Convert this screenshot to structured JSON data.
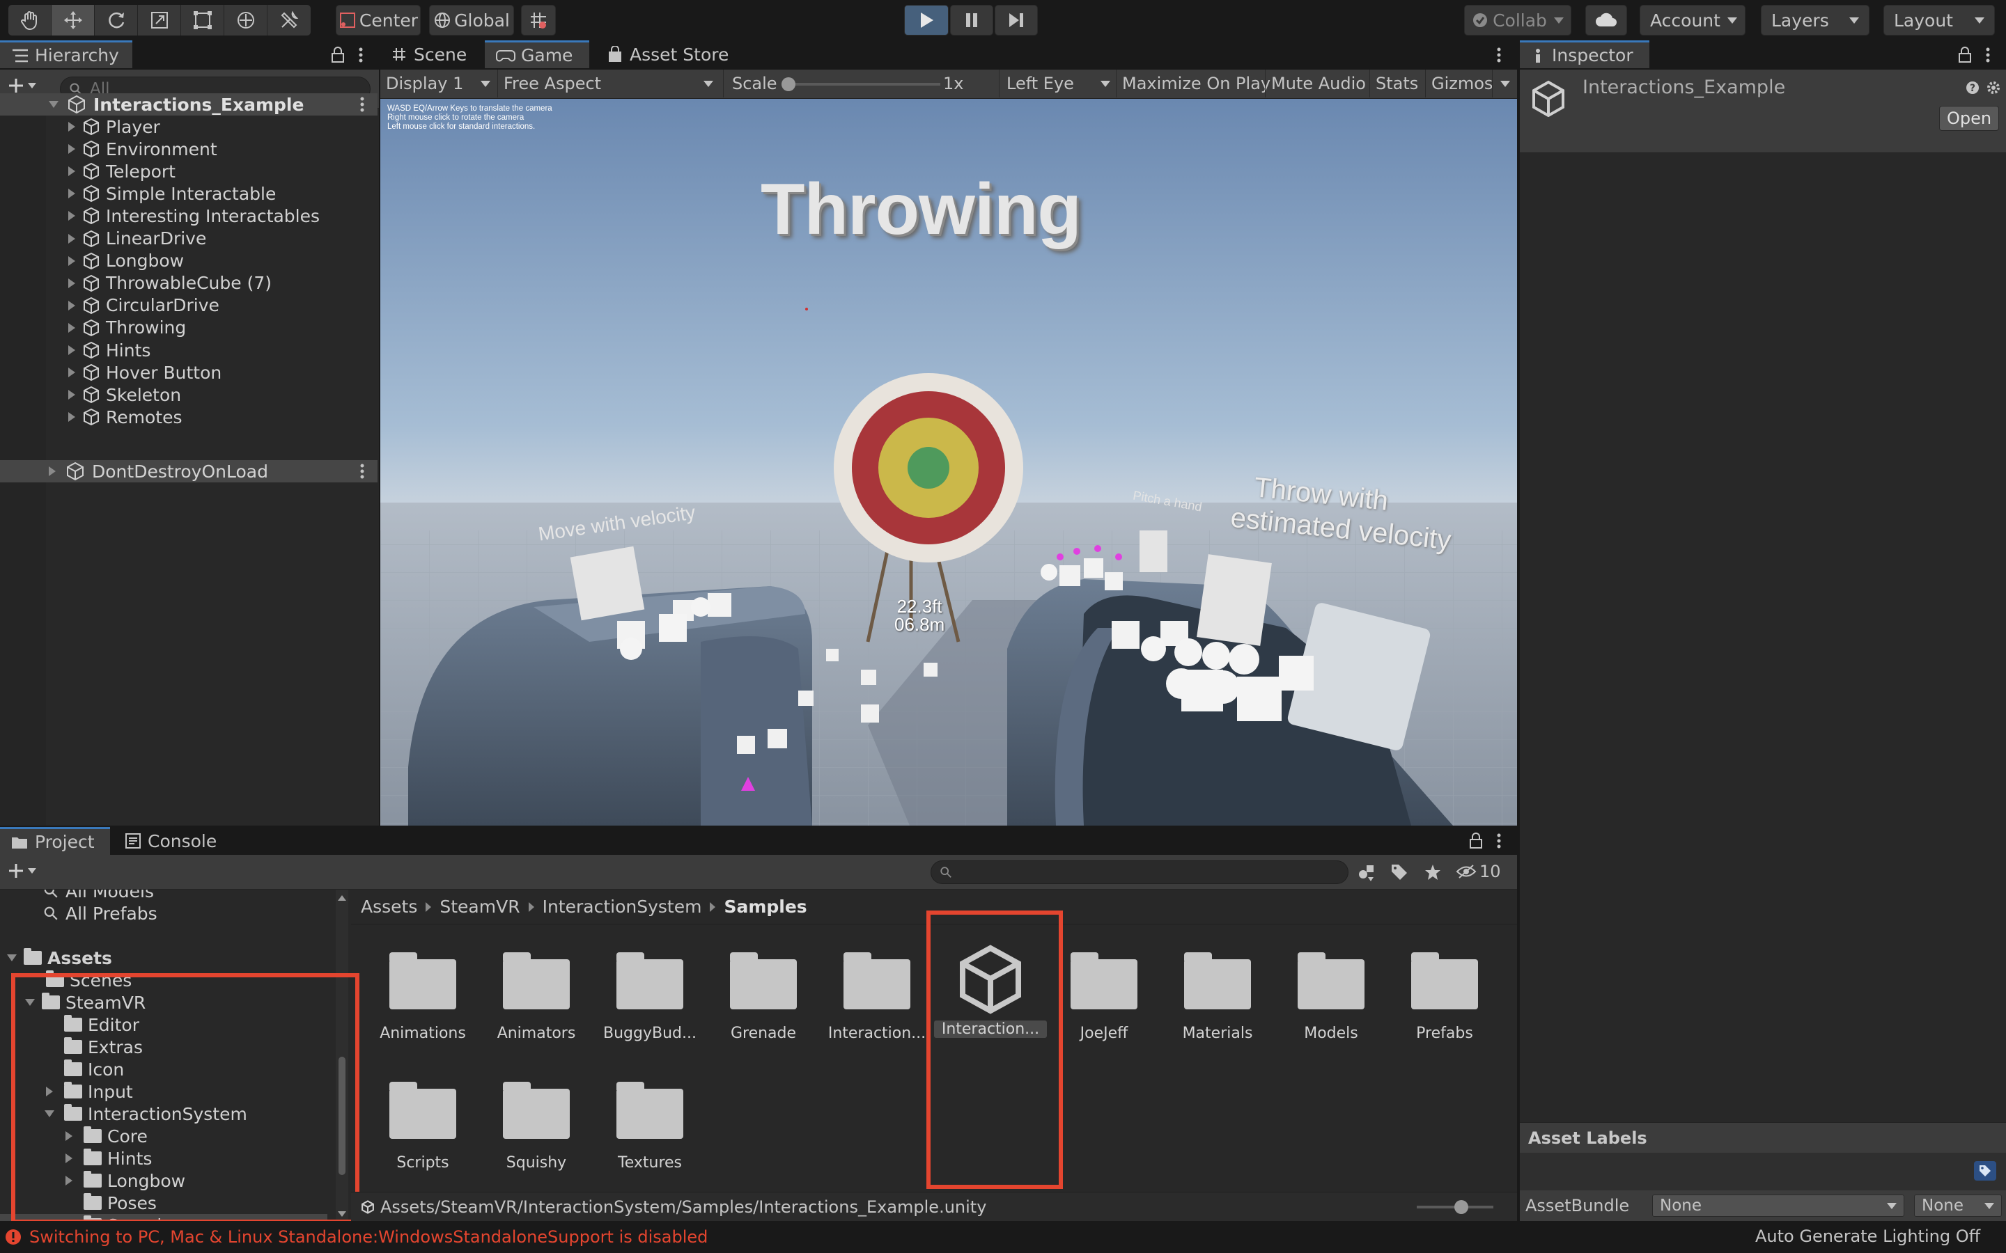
{
  "toolbar": {
    "pivot": "Center",
    "space": "Global",
    "collab": "Collab",
    "account": "Account",
    "layers": "Layers",
    "layout": "Layout"
  },
  "hierarchy": {
    "tab": "Hierarchy",
    "search_placeholder": "All",
    "scene": "Interactions_Example",
    "items": [
      "Player",
      "Environment",
      "Teleport",
      "Simple Interactable",
      "Interesting Interactables",
      "LinearDrive",
      "Longbow",
      "ThrowableCube (7)",
      "CircularDrive",
      "Throwing",
      "Hints",
      "Hover Button",
      "Skeleton",
      "Remotes"
    ],
    "dont_destroy": "DontDestroyOnLoad"
  },
  "view_tabs": {
    "scene": "Scene",
    "game": "Game",
    "asset_store": "Asset Store"
  },
  "game_bar": {
    "display": "Display 1",
    "aspect": "Free Aspect",
    "scale_label": "Scale",
    "scale_value": "1x",
    "scale_slider": 0,
    "eye": "Left Eye",
    "maximize": "Maximize On Play",
    "mute": "Mute Audio",
    "stats": "Stats",
    "gizmos": "Gizmos"
  },
  "game_view": {
    "help_lines": [
      "WASD EQ/Arrow Keys to translate the camera",
      "Right mouse click to rotate the camera",
      "Left mouse click for standard interactions."
    ],
    "title": "Throwing",
    "distance_ft": "22.3ft",
    "distance_m": "06.8m",
    "left_sign": "Move with velocity",
    "right_sign_1": "Throw with",
    "right_sign_2": "estimated velocity",
    "small_sign": "Pitch a hand"
  },
  "inspector": {
    "tab": "Inspector",
    "object_name": "Interactions_Example",
    "open_button": "Open",
    "asset_labels": "Asset Labels",
    "asset_bundle_label": "AssetBundle",
    "asset_bundle_value": "None",
    "asset_bundle_variant": "None"
  },
  "project": {
    "tab_project": "Project",
    "tab_console": "Console",
    "hidden_count": "10",
    "tree_partial": "All Models",
    "tree": {
      "all_prefabs": "All Prefabs",
      "assets": "Assets",
      "scenes": "Scenes",
      "steamvr": "SteamVR",
      "editor": "Editor",
      "extras": "Extras",
      "icon": "Icon",
      "input": "Input",
      "interaction_system": "InteractionSystem",
      "core": "Core",
      "hints": "Hints",
      "longbow": "Longbow",
      "poses": "Poses",
      "samples": "Samples"
    },
    "breadcrumb": [
      "Assets",
      "SteamVR",
      "InteractionSystem",
      "Samples"
    ],
    "grid_row1": [
      "Animations",
      "Animators",
      "BuggyBud...",
      "Grenade",
      "Interaction...",
      "Interaction...",
      "JoeJeff",
      "Materials",
      "Models",
      "Prefabs"
    ],
    "grid_row2": [
      "Scripts",
      "Squishy",
      "Textures"
    ],
    "path": "Assets/SteamVR/InteractionSystem/Samples/Interactions_Example.unity",
    "zoom": 0.6
  },
  "status": {
    "message": "Switching to PC, Mac & Linux Standalone:WindowsStandaloneSupport is disabled",
    "lighting": "Auto Generate Lighting Off"
  },
  "colors": {
    "accent": "#3a79bb",
    "error": "#e4452f",
    "highlight_box": "#e4452f"
  }
}
